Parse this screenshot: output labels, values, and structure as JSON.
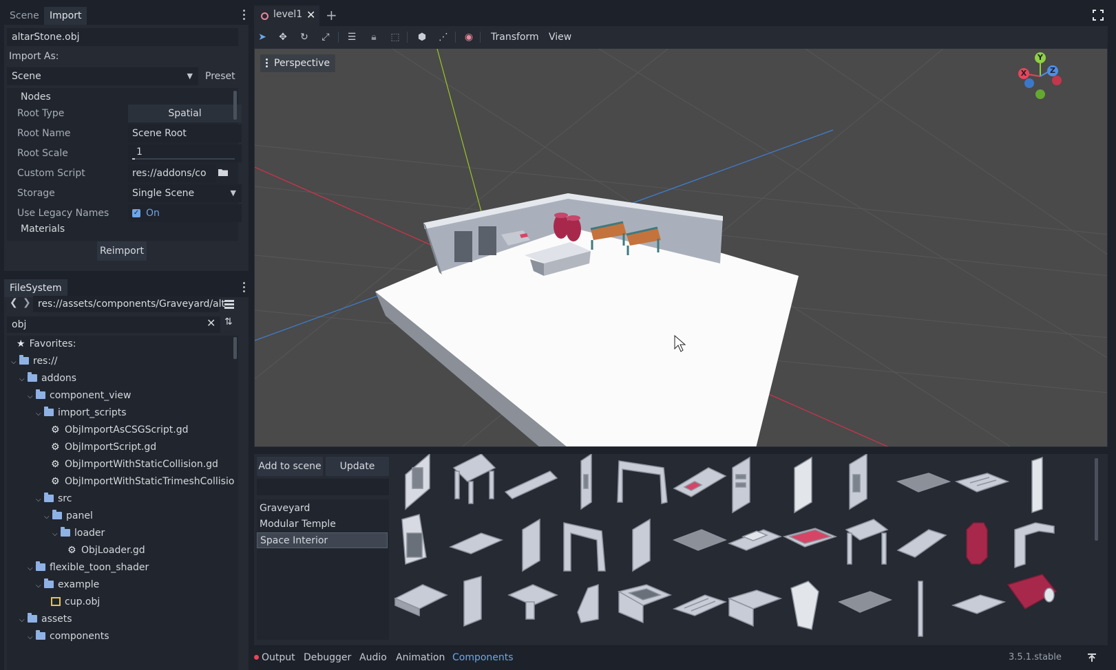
{
  "import_dock": {
    "tabs": [
      "Scene",
      "Import"
    ],
    "file_name": "altarStone.obj",
    "import_as_label": "Import As:",
    "import_as_value": "Scene",
    "preset_label": "Preset",
    "nodes_section": "Nodes",
    "materials_section": "Materials",
    "properties": [
      {
        "label": "Root Type",
        "value": "Spatial"
      },
      {
        "label": "Root Name",
        "value": "Scene Root"
      },
      {
        "label": "Root Scale",
        "value": "1"
      },
      {
        "label": "Custom Script",
        "value": "res://addons/co"
      },
      {
        "label": "Storage",
        "value": "Single Scene"
      },
      {
        "label": "Use Legacy Names",
        "value": "On"
      }
    ],
    "reimport_label": "Reimport"
  },
  "filesystem": {
    "tab": "FileSystem",
    "path": "res://assets/components/Graveyard/alt",
    "filter": "obj",
    "tree": [
      {
        "label": "Favorites:",
        "kind": "star"
      },
      {
        "label": "res://",
        "kind": "folder"
      },
      {
        "label": "addons",
        "kind": "folder"
      },
      {
        "label": "component_view",
        "kind": "folder"
      },
      {
        "label": "import_scripts",
        "kind": "folder"
      },
      {
        "label": "ObjImportAsCSGScript.gd",
        "kind": "gear"
      },
      {
        "label": "ObjImportScript.gd",
        "kind": "gear"
      },
      {
        "label": "ObjImportWithStaticCollision.gd",
        "kind": "gear"
      },
      {
        "label": "ObjImportWithStaticTrimeshCollisio",
        "kind": "gear"
      },
      {
        "label": "src",
        "kind": "folder"
      },
      {
        "label": "panel",
        "kind": "folder"
      },
      {
        "label": "loader",
        "kind": "folder"
      },
      {
        "label": "ObjLoader.gd",
        "kind": "gear"
      },
      {
        "label": "flexible_toon_shader",
        "kind": "folder"
      },
      {
        "label": "example",
        "kind": "folder"
      },
      {
        "label": "cup.obj",
        "kind": "mesh"
      },
      {
        "label": "assets",
        "kind": "folder"
      },
      {
        "label": "components",
        "kind": "folder"
      }
    ]
  },
  "editor": {
    "scene_tab": "level1",
    "menus": [
      "Transform",
      "View"
    ],
    "viewport_mode": "Perspective",
    "gizmo_axes": [
      "X",
      "Y",
      "Z"
    ]
  },
  "components_panel": {
    "add_button": "Add to scene",
    "update_button": "Update",
    "categories": [
      "Graveyard",
      "Modular Temple",
      "Space Interior"
    ],
    "selected_category": "Space Interior"
  },
  "bottom_tabs": [
    "Output",
    "Debugger",
    "Audio",
    "Animation",
    "Components"
  ],
  "active_bottom_tab": "Components",
  "version": "3.5.1.stable",
  "colors": {
    "accent": "#6ea6e8",
    "background": "#1d2129",
    "panel": "#252a33",
    "viewport": "#4a4a4a",
    "x_axis": "#e8455a",
    "y_axis": "#8fd142",
    "z_axis": "#4c8fe8"
  }
}
